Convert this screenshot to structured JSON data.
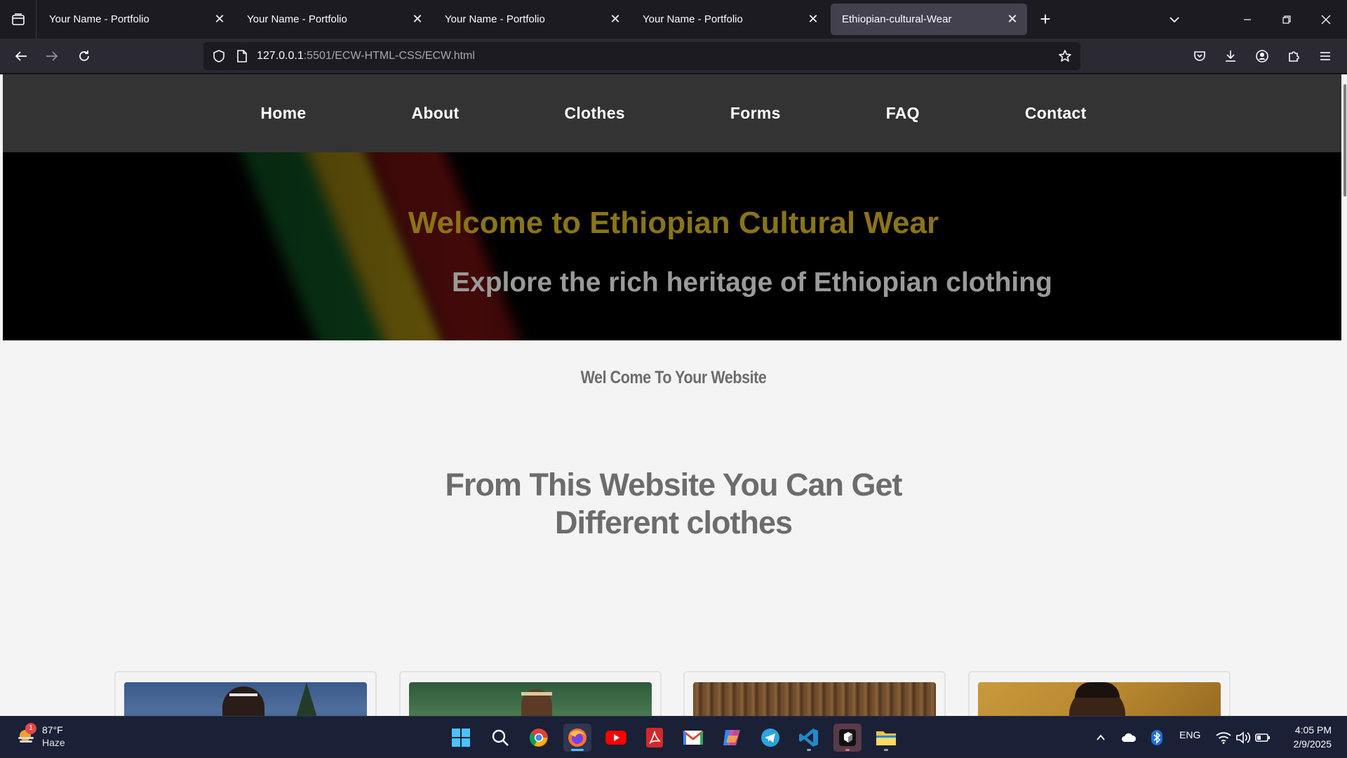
{
  "browser": {
    "tabs": [
      {
        "title": "Your Name - Portfolio",
        "active": false
      },
      {
        "title": "Your Name - Portfolio",
        "active": false
      },
      {
        "title": "Your Name - Portfolio",
        "active": false
      },
      {
        "title": "Your Name - Portfolio",
        "active": false
      },
      {
        "title": "Ethiopian-cultural-Wear",
        "active": true
      }
    ],
    "url_host": "127.0.0.1",
    "url_rest": ":5501/ECW-HTML-CSS/ECW.html"
  },
  "site": {
    "nav": [
      "Home",
      "About",
      "Clothes",
      "Forms",
      "FAQ",
      "Contact"
    ],
    "hero_title": "Welcome to Ethiopian Cultural Wear",
    "hero_subtitle": "Explore the rich heritage of Ethiopian clothing",
    "welcome": "Wel Come To Your Website",
    "headline": "From This Website You Can Get Different clothes",
    "cards": [
      {
        "name": "card-1"
      },
      {
        "name": "card-2"
      },
      {
        "name": "card-3"
      },
      {
        "name": "card-4"
      }
    ]
  },
  "taskbar": {
    "weather_badge": "1",
    "weather_temp": "87°F",
    "weather_cond": "Haze",
    "apps": [
      "start-icon",
      "search-icon",
      "chrome-icon",
      "firefox-icon",
      "youtube-icon",
      "acrobat-icon",
      "gmail-icon",
      "copilot-icon",
      "telegram-icon",
      "vscode-icon",
      "terminal-icon",
      "file-explorer-icon"
    ],
    "language": "ENG",
    "time": "4:05 PM",
    "date": "2/9/2025"
  },
  "colors": {
    "hero_title": "#8a7418",
    "site_nav_bg": "#333333",
    "page_bg": "#f4f4f4",
    "text_gray": "#6c6c6c"
  }
}
